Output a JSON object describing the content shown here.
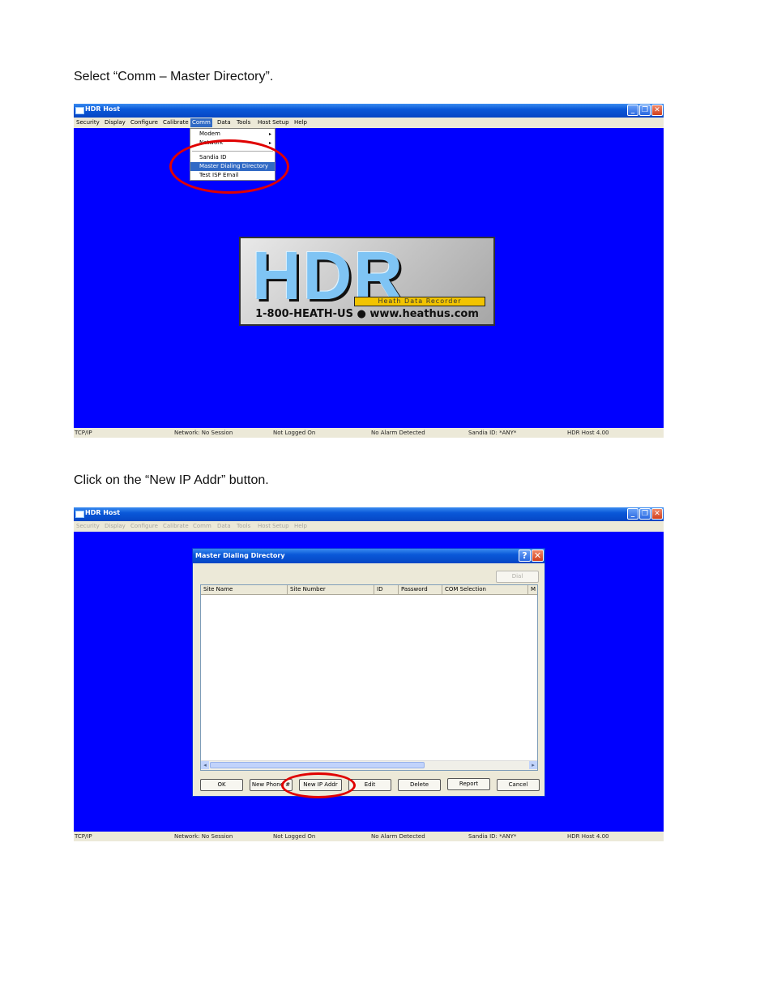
{
  "instructions": {
    "step1": "Select “Comm – Master Directory”.",
    "step2": "Click on the “New IP Addr” button."
  },
  "app": {
    "title": "HDR Host",
    "window_buttons": {
      "minimize": "_",
      "maximize": "❐",
      "close": "✕"
    },
    "menu": [
      "Security",
      "Display",
      "Configure",
      "Calibrate",
      "Comm",
      "Data",
      "Tools",
      "Host Setup",
      "Help"
    ],
    "active_menu": "Comm",
    "status": [
      "TCP/IP",
      "Network: No Session",
      "Not Logged On",
      "No Alarm Detected",
      "Sandia ID: *ANY*",
      "HDR Host 4.00"
    ]
  },
  "comm_menu": {
    "items": [
      "Modem",
      "Network",
      "Sandia ID",
      "Master Dialing Directory",
      "Test ISP Email"
    ],
    "submenu_arrow": "▸",
    "selected": "Master Dialing Directory"
  },
  "logo": {
    "big": "HDR",
    "subtitle": "Heath Data Recorder",
    "contact": "1-800-HEATH-US ● www.heathus.com"
  },
  "dialog": {
    "title": "Master Dialing Directory",
    "help_button": "?",
    "close_button": "✕",
    "dial_button": "Dial",
    "columns": [
      "Site Name",
      "Site Number",
      "ID",
      "Password",
      "COM Selection",
      "M"
    ],
    "scroll_left": "◂",
    "scroll_right": "▸",
    "buttons": [
      "OK",
      "New Phone #",
      "New IP Addr",
      "Edit",
      "Delete",
      "Report",
      "Cancel"
    ]
  },
  "colors": {
    "desktop": "#0000ff",
    "highlight": "#e00000",
    "titlebar": "#0a58d8",
    "menu_selection": "#316ac5"
  }
}
